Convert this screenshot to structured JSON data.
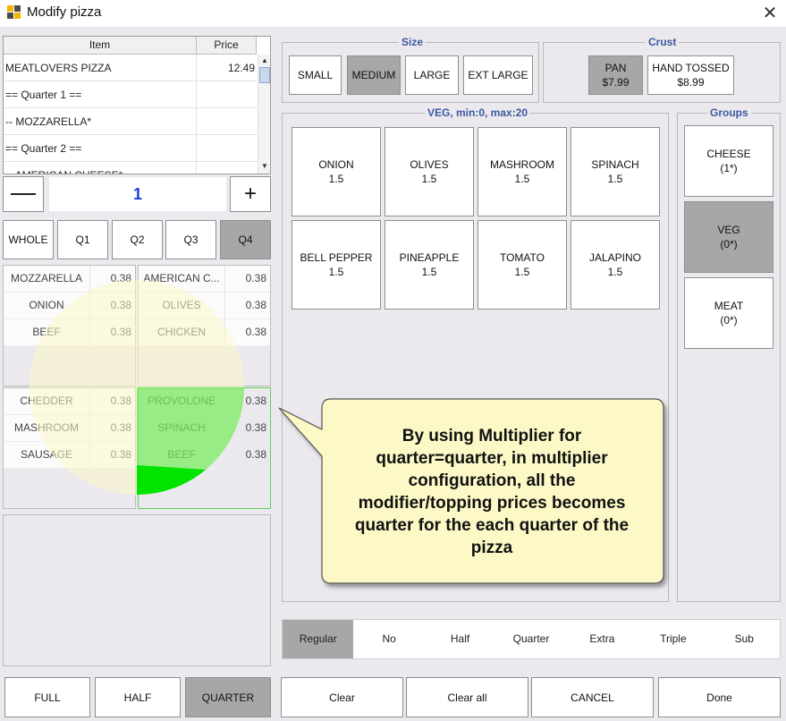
{
  "window": {
    "title": "Modify pizza"
  },
  "colors": {
    "accent_blue": "#3c5aa0",
    "qty_blue": "#1a3fd6",
    "selected_gray": "#a7a7a7",
    "callout_fill": "#fcf9c6",
    "highlight_green": "#00e400"
  },
  "order": {
    "col_item": "Item",
    "col_price": "Price",
    "rows": [
      {
        "name": "MEATLOVERS PIZZA",
        "price": "12.49"
      },
      {
        "name": "== Quarter 1 ==",
        "price": ""
      },
      {
        "name": " -- MOZZARELLA*",
        "price": ""
      },
      {
        "name": "== Quarter 2 ==",
        "price": ""
      },
      {
        "name": " -- AMERICAN CHEESE*",
        "price": ""
      }
    ]
  },
  "quantity": {
    "minus_icon": "minus-icon",
    "plus_icon": "plus-icon",
    "value": "1"
  },
  "portion_tabs": [
    "WHOLE",
    "Q1",
    "Q2",
    "Q3",
    "Q4"
  ],
  "portion_selected": "Q4",
  "quarters": [
    {
      "items": [
        {
          "name": "MOZZARELLA",
          "price": "0.38"
        },
        {
          "name": "ONION",
          "price": "0.38"
        },
        {
          "name": "BEEF",
          "price": "0.38"
        }
      ]
    },
    {
      "items": [
        {
          "name": "AMERICAN C...",
          "price": "0.38"
        },
        {
          "name": "OLIVES",
          "price": "0.38"
        },
        {
          "name": "CHICKEN",
          "price": "0.38"
        }
      ]
    },
    {
      "items": [
        {
          "name": "CHEDDER",
          "price": "0.38"
        },
        {
          "name": "MASHROOM",
          "price": "0.38"
        },
        {
          "name": "SAUSAGE",
          "price": "0.38"
        }
      ]
    },
    {
      "items": [
        {
          "name": "PROVOLONE",
          "price": "0.38"
        },
        {
          "name": "SPINACH",
          "price": "0.38"
        },
        {
          "name": "BEEF",
          "price": "0.38"
        }
      ]
    }
  ],
  "size": {
    "title": "Size",
    "options": [
      "SMALL",
      "MEDIUM",
      "LARGE",
      "EXT LARGE"
    ],
    "selected": "MEDIUM"
  },
  "crust": {
    "title": "Crust",
    "options": [
      {
        "name": "PAN",
        "price": "$7.99"
      },
      {
        "name": "HAND TOSSED",
        "price": "$8.99"
      }
    ],
    "selected": "PAN"
  },
  "modifiers": {
    "title": "VEG, min:0, max:20",
    "items": [
      {
        "name": "ONION",
        "price": "1.5"
      },
      {
        "name": "OLIVES",
        "price": "1.5"
      },
      {
        "name": "MASHROOM",
        "price": "1.5"
      },
      {
        "name": "SPINACH",
        "price": "1.5"
      },
      {
        "name": "BELL PEPPER",
        "price": "1.5"
      },
      {
        "name": "PINEAPPLE",
        "price": "1.5"
      },
      {
        "name": "TOMATO",
        "price": "1.5"
      },
      {
        "name": "JALAPINO",
        "price": "1.5"
      }
    ]
  },
  "groups": {
    "title": "Groups",
    "items": [
      {
        "name": "CHEESE",
        "count": "(1*)"
      },
      {
        "name": "VEG",
        "count": "(0*)"
      },
      {
        "name": "MEAT",
        "count": "(0*)"
      }
    ],
    "selected": "VEG"
  },
  "callout": {
    "text": "By using Multiplier for quarter=quarter, in multiplier configuration, all the modifier/topping prices becomes quarter for the each quarter of the pizza"
  },
  "portion_amounts": {
    "options": [
      "Regular",
      "No",
      "Half",
      "Quarter",
      "Extra",
      "Triple",
      "Sub"
    ],
    "selected": "Regular"
  },
  "bottom": {
    "left": [
      "FULL",
      "HALF",
      "QUARTER"
    ],
    "left_selected": "QUARTER",
    "right": [
      "Clear",
      "Clear all",
      "CANCEL",
      "Done"
    ]
  }
}
